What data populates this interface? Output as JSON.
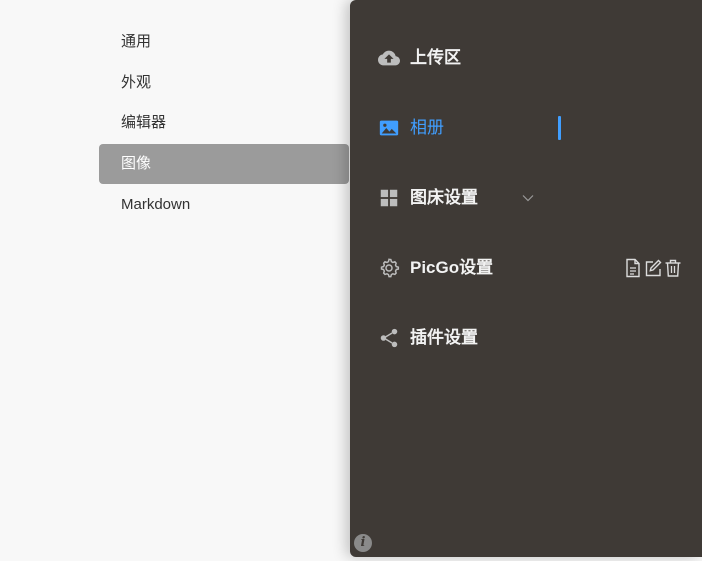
{
  "settings_menu": {
    "items": [
      {
        "label": "通用",
        "active": false
      },
      {
        "label": "外观",
        "active": false
      },
      {
        "label": "编辑器",
        "active": false
      },
      {
        "label": "图像",
        "active": true
      },
      {
        "label": "Markdown",
        "active": false
      }
    ]
  },
  "picgo_sidebar": {
    "items": [
      {
        "label": "上传区",
        "icon": "cloud-upload-icon",
        "active": false
      },
      {
        "label": "相册",
        "icon": "image-icon",
        "active": true
      },
      {
        "label": "图床设置",
        "icon": "grid-icon",
        "active": false,
        "has_submenu": true
      },
      {
        "label": "PicGo设置",
        "icon": "gear-icon",
        "active": false
      },
      {
        "label": "插件设置",
        "icon": "share-icon",
        "active": false
      }
    ],
    "actions": [
      "document-icon",
      "edit-icon",
      "trash-icon"
    ],
    "info_badge": "i"
  },
  "colors": {
    "sidebar_bg": "#3f3a36",
    "accent": "#409eff",
    "active_settings_bg": "#9b9b9b"
  }
}
